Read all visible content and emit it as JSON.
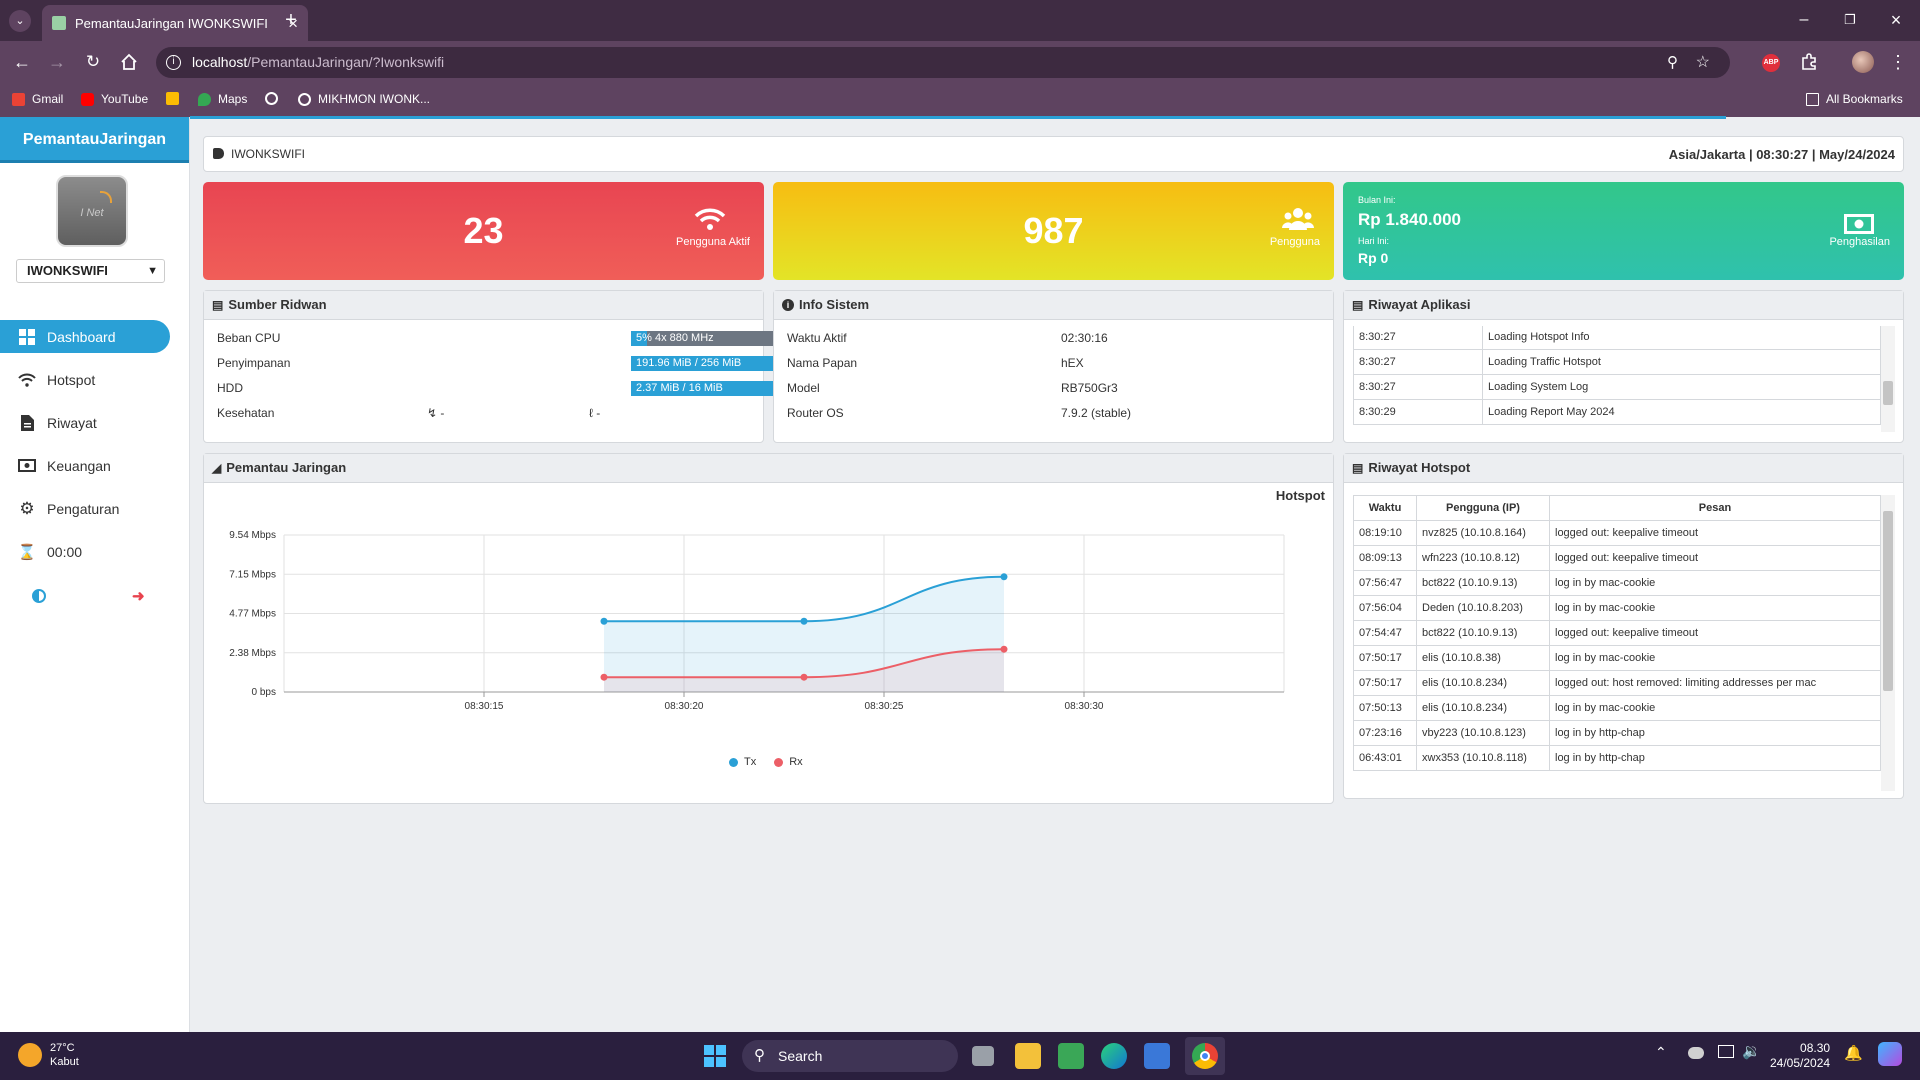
{
  "browser": {
    "tab_title": "PemantauJaringan IWONKSWIFI",
    "url_host": "localhost",
    "url_path": "/PemantauJaringan/?Iwonkswifi",
    "bookmarks": [
      "Gmail",
      "YouTube",
      "Maps",
      "MIKHMON IWONK..."
    ],
    "all_bookmarks": "All Bookmarks"
  },
  "sidebar": {
    "brand": "PemantauJaringan",
    "logo_text": "I Net",
    "router": "IWONKSWIFI",
    "nav": [
      {
        "label": "Dashboard",
        "icon": "dashboard-icon"
      },
      {
        "label": "Hotspot",
        "icon": "wifi-icon"
      },
      {
        "label": "Riwayat",
        "icon": "document-icon"
      },
      {
        "label": "Keuangan",
        "icon": "money-icon"
      },
      {
        "label": "Pengaturan",
        "icon": "gear-icon"
      },
      {
        "label": "00:00",
        "icon": "hourglass-icon"
      }
    ]
  },
  "header": {
    "router_name": "IWONKSWIFI",
    "datetime": "Asia/Jakarta | 08:30:27 | May/24/2024"
  },
  "stats": {
    "active": {
      "value": "23",
      "label": "Pengguna Aktif",
      "color": "#e8434e"
    },
    "users": {
      "value": "987",
      "label": "Pengguna",
      "color": "#f2c21a"
    },
    "income": {
      "month_label": "Bulan Ini:",
      "month_value": "Rp 1.840.000",
      "day_label": "Hari Ini:",
      "day_value": "Rp 0",
      "label": "Penghasilan",
      "color": "#2fc4a0"
    }
  },
  "resources": {
    "title": "Sumber Ridwan",
    "rows": [
      {
        "label": "Beban CPU",
        "bar": "5% 4x 880 MHz",
        "fill": 0.05
      },
      {
        "label": "Penyimpanan",
        "bar": "191.96 MiB / 256 MiB",
        "fill": 0.75
      },
      {
        "label": "HDD",
        "bar": "2.37 MiB / 16 MiB",
        "fill": 0.85
      }
    ],
    "health_label": "Kesehatan",
    "health_voltage": "-",
    "health_temp": "-"
  },
  "sysinfo": {
    "title": "Info Sistem",
    "rows": [
      {
        "label": "Waktu Aktif",
        "value": "02:30:16"
      },
      {
        "label": "Nama Papan",
        "value": "hEX"
      },
      {
        "label": "Model",
        "value": "RB750Gr3"
      },
      {
        "label": "Router OS",
        "value": "7.9.2 (stable)"
      }
    ]
  },
  "applog": {
    "title": "Riwayat Aplikasi",
    "rows": [
      {
        "time": "8:30:27",
        "msg": "Loading Hotspot Info"
      },
      {
        "time": "8:30:27",
        "msg": "Loading Traffic Hotspot"
      },
      {
        "time": "8:30:27",
        "msg": "Loading System Log"
      },
      {
        "time": "8:30:29",
        "msg": "Loading Report May 2024"
      }
    ]
  },
  "traffic": {
    "title": "Pemantau Jaringan",
    "subtitle": "Hotspot",
    "legend_tx": "Tx",
    "legend_rx": "Rx"
  },
  "chart_data": {
    "type": "area",
    "title": "Hotspot",
    "x": [
      "08:30:18",
      "08:30:23",
      "08:30:28"
    ],
    "x_ticks": [
      "08:30:15",
      "08:30:20",
      "08:30:25",
      "08:30:30"
    ],
    "y_ticks": [
      "9.54 Mbps",
      "7.15 Mbps",
      "4.77 Mbps",
      "2.38 Mbps",
      "0 bps"
    ],
    "ylim": [
      0,
      9.54
    ],
    "series": [
      {
        "name": "Tx",
        "color": "#2aa0d6",
        "values": [
          4.3,
          4.3,
          7.0
        ]
      },
      {
        "name": "Rx",
        "color": "#ec5f67",
        "values": [
          0.9,
          0.9,
          2.6
        ]
      }
    ],
    "legend": "bottom",
    "grid": true
  },
  "hotspot_log": {
    "title": "Riwayat Hotspot",
    "headers": [
      "Waktu",
      "Pengguna (IP)",
      "Pesan"
    ],
    "rows": [
      [
        "08:19:10",
        "nvz825 (10.10.8.164)",
        "logged out: keepalive timeout"
      ],
      [
        "08:09:13",
        "wfn223 (10.10.8.12)",
        "logged out: keepalive timeout"
      ],
      [
        "07:56:47",
        "bct822 (10.10.9.13)",
        "log in by mac-cookie"
      ],
      [
        "07:56:04",
        "Deden (10.10.8.203)",
        "log in by mac-cookie"
      ],
      [
        "07:54:47",
        "bct822 (10.10.9.13)",
        "logged out: keepalive timeout"
      ],
      [
        "07:50:17",
        "elis (10.10.8.38)",
        "log in by mac-cookie"
      ],
      [
        "07:50:17",
        "elis (10.10.8.234)",
        "logged out: host removed: limiting addresses per mac"
      ],
      [
        "07:50:13",
        "elis (10.10.8.234)",
        "log in by mac-cookie"
      ],
      [
        "07:23:16",
        "vby223 (10.10.8.123)",
        "log in by http-chap"
      ],
      [
        "06:43:01",
        "xwx353 (10.10.8.118)",
        "log in by http-chap"
      ]
    ]
  },
  "taskbar": {
    "temp": "27°C",
    "weather": "Kabut",
    "search": "Search",
    "time": "08.30",
    "date": "24/05/2024"
  }
}
